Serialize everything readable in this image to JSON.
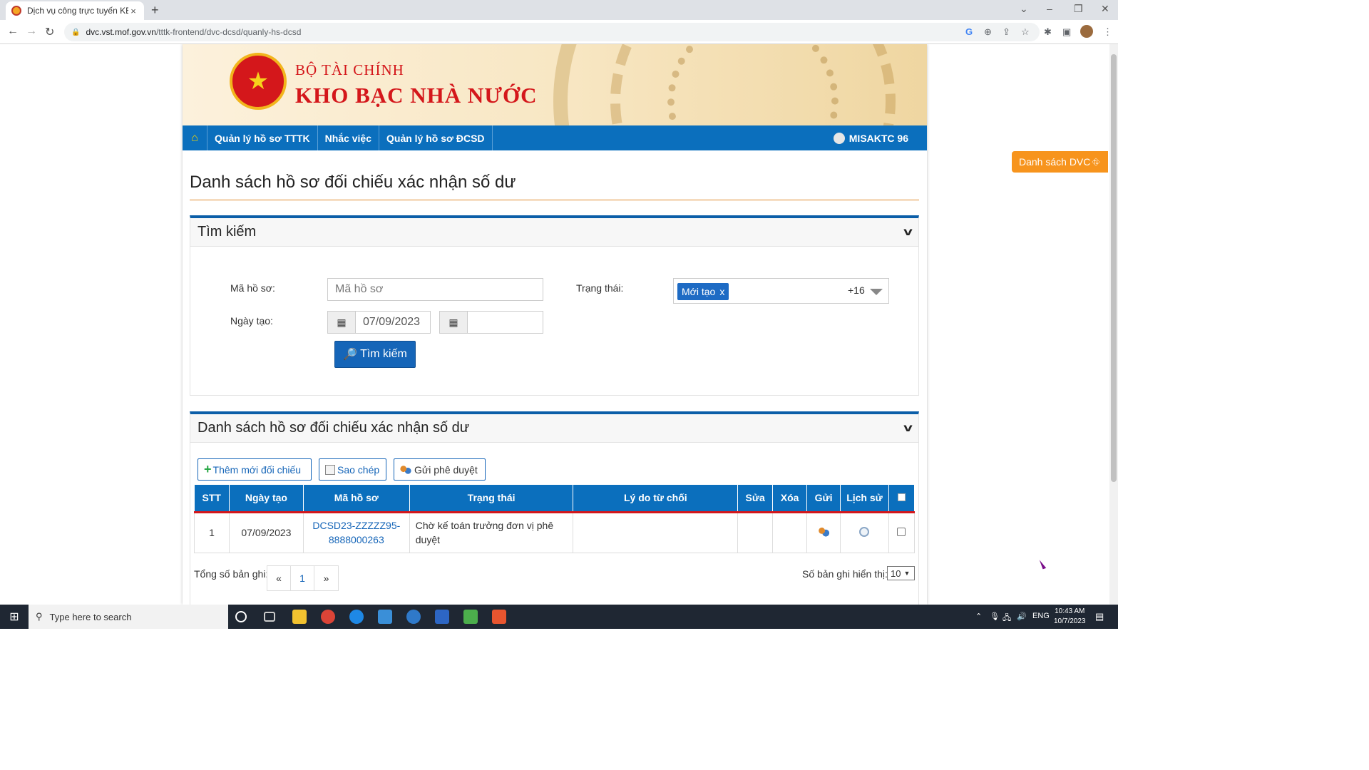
{
  "browser": {
    "tab_title": "Dịch vụ công trực tuyến KBNN",
    "tab_close": "×",
    "new_tab": "+",
    "url_host": "dvc.vst.mof.gov.vn",
    "url_path": "/tttk-frontend/dvc-dcsd/quanly-hs-dcsd"
  },
  "banner": {
    "org_line1": "BỘ TÀI CHÍNH",
    "org_line2": "KHO BẠC NHÀ NƯỚC"
  },
  "nav": {
    "items": [
      "Quản lý hồ sơ TTTK",
      "Nhắc việc",
      "Quản lý hồ sơ ĐCSD"
    ],
    "user": "MISAKTC 96"
  },
  "page_title": "Danh sách hồ sơ đối chiếu xác nhận số dư",
  "search": {
    "title": "Tìm kiếm",
    "ma_ho_so_label": "Mã hồ sơ:",
    "ma_ho_so_placeholder": "Mã hồ sơ",
    "ngay_tao_label": "Ngày tạo:",
    "from_date": "07/09/2023",
    "to_date": "",
    "trang_thai_label": "Trạng thái:",
    "trang_thai_chip": "Mới tạo",
    "chip_remove": "x",
    "trang_thai_more": "+16",
    "search_button": "Tìm kiếm"
  },
  "list": {
    "title": "Danh sách hồ sơ đối chiếu xác nhận số dư",
    "btn_add": "Thêm mới đối chiếu",
    "btn_copy": "Sao chép",
    "btn_send": "Gửi phê duyệt",
    "columns": [
      "STT",
      "Ngày tạo",
      "Mã hồ sơ",
      "Trạng thái",
      "Lý do từ chối",
      "Sửa",
      "Xóa",
      "Gửi",
      "Lịch sử"
    ],
    "rows": [
      {
        "stt": "1",
        "ngay_tao": "07/09/2023",
        "ma_ho_so_1": "DCSD23-ZZZZZ95-",
        "ma_ho_so_2": "8888000263",
        "trang_thai_1": "Chờ kế toán trưởng đơn vị phê",
        "trang_thai_2": "duyệt",
        "ly_do": ""
      }
    ],
    "total_label": "Tổng số bản ghi:",
    "pager_prev": "«",
    "pager_current": "1",
    "pager_next": "»",
    "per_page_label": "Số bản ghi hiển thị:",
    "per_page_value": "10"
  },
  "floating_button": "Danh sách DVC",
  "taskbar": {
    "search_placeholder": "Type here to search",
    "lang": "ENG",
    "time": "10:43 AM",
    "date": "10/7/2023"
  }
}
